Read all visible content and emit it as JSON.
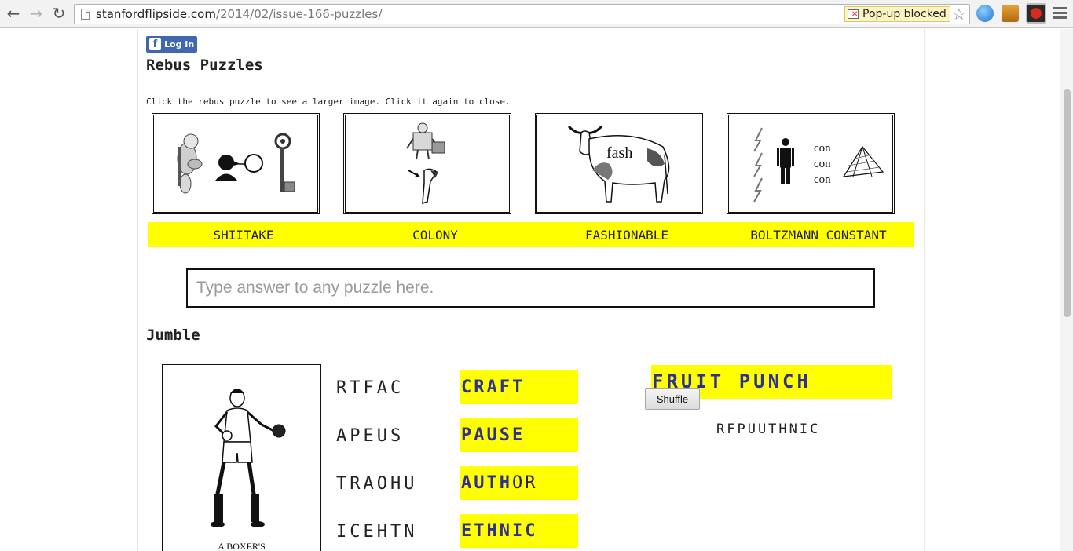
{
  "browser": {
    "url_host": "stanfordflipside.com",
    "url_path": "/2014/02/issue-166-puzzles/",
    "popup_blocked": "Pop-up blocked"
  },
  "facebook": {
    "login_label": "Log In"
  },
  "rebus": {
    "heading": "Rebus Puzzles",
    "instructions": "Click the rebus puzzle to see a larger image. Click it again to close.",
    "puzzles": [
      {
        "answer": "SHIITAKE",
        "image_text": []
      },
      {
        "answer": "COLONY",
        "image_text": []
      },
      {
        "answer": "FASHIONABLE",
        "image_text": [
          "fash"
        ]
      },
      {
        "answer": "BOLTZMANN CONSTANT",
        "image_text": [
          "con",
          "con",
          "con"
        ]
      }
    ],
    "input_placeholder": "Type answer to any puzzle here."
  },
  "jumble": {
    "heading": "Jumble",
    "image_caption": "A BOXER'S",
    "words": [
      {
        "scrambled": "RTFAC",
        "solved_bold": "CRAFT",
        "solved_rest": ""
      },
      {
        "scrambled": "APEUS",
        "solved_bold": "PAUSE",
        "solved_rest": ""
      },
      {
        "scrambled": "TRAOHU",
        "solved_bold": "AUTH",
        "solved_rest": "OR"
      },
      {
        "scrambled": "ICEHTN",
        "solved_bold": "ETHNIC",
        "solved_rest": ""
      }
    ],
    "final_answer": "FRUIT PUNCH",
    "shuffle_label": "Shuffle",
    "final_scrambled": "RFPUUTHNIC"
  },
  "colors": {
    "highlight": "#ffff00",
    "solved_text": "#2e3192",
    "facebook": "#4267b2"
  }
}
